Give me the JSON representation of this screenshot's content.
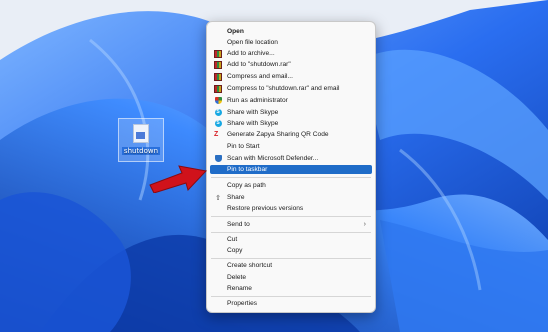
{
  "desktop": {
    "icon_label": "shutdown"
  },
  "context_menu": {
    "items": [
      {
        "label": "Open",
        "icon": "none",
        "bold": true
      },
      {
        "label": "Open file location",
        "icon": "none"
      },
      {
        "label": "Add to archive...",
        "icon": "winrar-icon"
      },
      {
        "label": "Add to \"shutdown.rar\"",
        "icon": "winrar-icon"
      },
      {
        "label": "Compress and email...",
        "icon": "winrar-icon"
      },
      {
        "label": "Compress to \"shutdown.rar\" and email",
        "icon": "winrar-icon"
      },
      {
        "label": "Run as administrator",
        "icon": "uac-shield-icon"
      },
      {
        "label": "Share with Skype",
        "icon": "skype-icon"
      },
      {
        "label": "Share with Skype",
        "icon": "skype-icon"
      },
      {
        "label": "Generate Zapya Sharing QR Code",
        "icon": "zapya-icon"
      },
      {
        "label": "Pin to Start",
        "icon": "none"
      },
      {
        "label": "Scan with Microsoft Defender...",
        "icon": "defender-icon"
      },
      {
        "label": "Pin to taskbar",
        "icon": "none",
        "highlighted": true
      },
      {
        "label": "Copy as path",
        "icon": "none"
      },
      {
        "label": "Share",
        "icon": "share-icon"
      },
      {
        "label": "Restore previous versions",
        "icon": "none"
      },
      {
        "label": "Send to",
        "icon": "none",
        "submenu": true
      },
      {
        "label": "Cut",
        "icon": "none"
      },
      {
        "label": "Copy",
        "icon": "none"
      },
      {
        "label": "Create shortcut",
        "icon": "none"
      },
      {
        "label": "Delete",
        "icon": "none"
      },
      {
        "label": "Rename",
        "icon": "none"
      },
      {
        "label": "Properties",
        "icon": "none"
      }
    ],
    "submenu_glyph": "›",
    "skype_glyph": "S",
    "zapya_glyph": "Z",
    "share_glyph": "⇧"
  },
  "colors": {
    "highlight": "#1f6cc8",
    "arrow": "#d0121b"
  }
}
